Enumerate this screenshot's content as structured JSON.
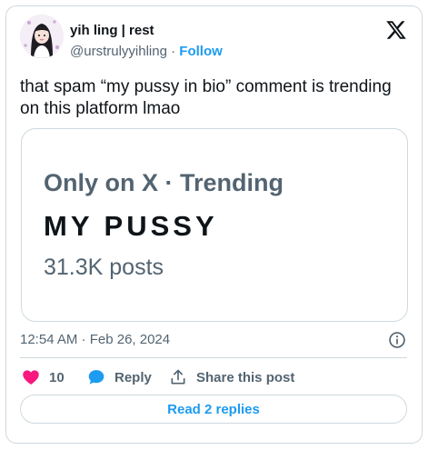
{
  "author": {
    "display_name": "yih ling | rest",
    "handle": "@urstrulyyihling",
    "separator": "·",
    "follow_label": "Follow"
  },
  "icons": {
    "avatar": "user-avatar",
    "brand": "x-logo-icon",
    "info": "info-icon",
    "like": "heart-icon",
    "reply": "speech-bubble-icon",
    "share": "share-upload-icon"
  },
  "tweet": {
    "text": "that spam “my pussy in bio” comment is trending on this platform lmao"
  },
  "trend_card": {
    "context": "Only on X · Trending",
    "name": "MY PUSSY",
    "count": "31.3K posts"
  },
  "meta": {
    "timestamp": "12:54 AM · Feb 26, 2024"
  },
  "actions": {
    "like_count": "10",
    "reply_label": "Reply",
    "share_label": "Share this post"
  },
  "replies_button": {
    "label": "Read 2 replies"
  },
  "colors": {
    "accent": "#1d9bf0",
    "like": "#f91880",
    "text": "#0f1419",
    "secondary": "#536471",
    "border": "#cfd9de"
  }
}
